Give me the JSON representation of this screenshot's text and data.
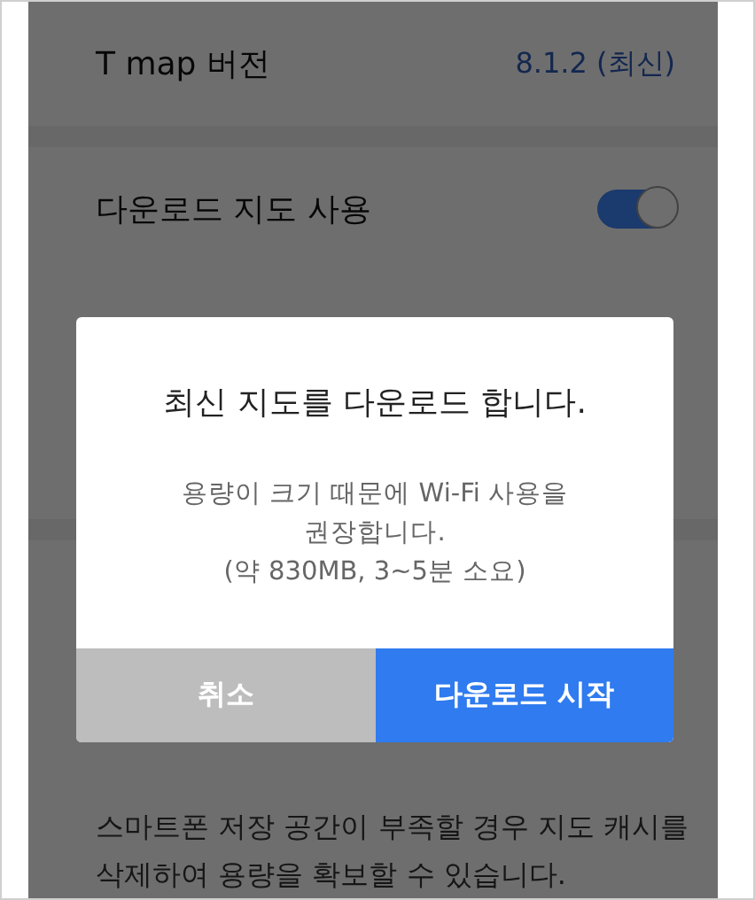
{
  "settings": [
    {
      "kind": "value",
      "label": "T map 버전",
      "value": "8.1.2 (최신)"
    },
    {
      "kind": "toggle",
      "label": "다운로드 지도 사용",
      "on": true
    }
  ],
  "note": [
    "스마트폰 저장 공간이 부족할 경우 지도 캐시를",
    "삭제하여 용량을 확보할 수 있습니다."
  ],
  "dialog": {
    "title": "최신 지도를 다운로드 합니다.",
    "message": [
      "용량이 크기 때문에 Wi-Fi 사용을",
      "권장합니다.",
      "(약 830MB, 3~5분 소요)"
    ],
    "buttons": [
      {
        "kind": "cancel",
        "label": "취소"
      },
      {
        "kind": "primary",
        "label": "다운로드 시작"
      }
    ]
  }
}
